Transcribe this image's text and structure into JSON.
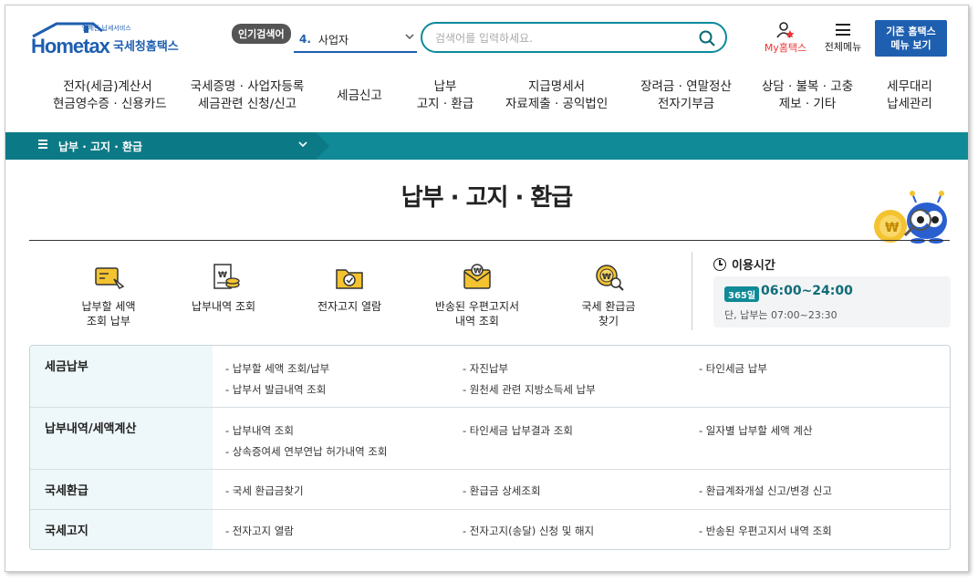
{
  "header": {
    "logo_word": "Hometax",
    "logo_tagline": "언제든 납세서비스",
    "logo_name": "국세청홈택스",
    "popular_label": "인기검색어",
    "popular_rank": "4.",
    "popular_term": "사업자",
    "search_placeholder": "검색어를 입력하세요.",
    "my_hometax": "My홈택스",
    "all_menu": "전체메뉴",
    "legacy_line1": "기존 홈택스",
    "legacy_line2": "메뉴 보기"
  },
  "gnb": [
    {
      "l1": "전자(세금)계산서",
      "l2": "현금영수증 · 신용카드"
    },
    {
      "l1": "국세증명 · 사업자등록",
      "l2": "세금관련 신청/신고"
    },
    {
      "l1": "세금신고",
      "l2": ""
    },
    {
      "l1": "납부",
      "l2": "고지 · 환급"
    },
    {
      "l1": "지급명세서",
      "l2": "자료제출 · 공익법인"
    },
    {
      "l1": "장려금 · 연말정산",
      "l2": "전자기부금"
    },
    {
      "l1": "상담 · 불복 · 고충",
      "l2": "제보 · 기타"
    },
    {
      "l1": "세무대리",
      "l2": "납세관리"
    }
  ],
  "location": {
    "label": "납부 · 고지 · 환급"
  },
  "page": {
    "title": "납부 · 고지 · 환급"
  },
  "quick_menu": [
    {
      "l1": "납부할 세액",
      "l2": "조회 납부",
      "icon": "document-pen-icon"
    },
    {
      "l1": "납부내역 조회",
      "l2": "",
      "icon": "receipt-coin-icon"
    },
    {
      "l1": "전자고지 열람",
      "l2": "",
      "icon": "folder-check-icon"
    },
    {
      "l1": "반송된 우편고지서",
      "l2": "내역 조회",
      "icon": "envelope-won-icon"
    },
    {
      "l1": "국세 환급금",
      "l2": "찾기",
      "icon": "won-search-icon"
    }
  ],
  "hours": {
    "title": "이용시간",
    "badge": "365일",
    "time": "06:00~24:00",
    "note": "단, 납부는 07:00~23:30"
  },
  "table": [
    {
      "head": "세금납부",
      "links": [
        "- 납부할 세액 조회/납부",
        "- 자진납부",
        "- 타인세금 납부",
        "- 납부서 발급내역 조회",
        "- 원천세 관련 지방소득세 납부",
        ""
      ]
    },
    {
      "head": "납부내역/세액계산",
      "links": [
        "- 납부내역 조회",
        "- 타인세금 납부결과 조회",
        "- 일자별 납부할 세액 계산",
        "- 상속증여세 연부연납 허가내역 조회",
        "",
        ""
      ]
    },
    {
      "head": "국세환급",
      "links": [
        "- 국세 환급금찾기",
        "- 환급금 상세조회",
        "- 환급계좌개설 신고/변경 신고"
      ]
    },
    {
      "head": "국세고지",
      "links": [
        "- 전자고지 열람",
        "- 전자고지(송달) 신청 및 해지",
        "- 반송된 우편고지서 내역 조회"
      ]
    }
  ],
  "colors": {
    "primary": "#1e5fb0",
    "teal": "#0f8a96",
    "accent_red": "#e33"
  }
}
